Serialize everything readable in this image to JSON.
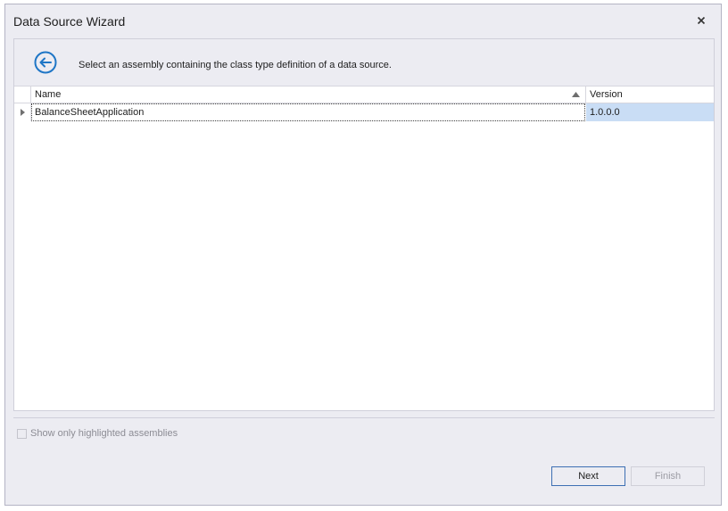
{
  "window": {
    "title": "Data Source Wizard"
  },
  "wizard": {
    "instruction": "Select an assembly containing the class type definition of a data source."
  },
  "grid": {
    "columns": [
      "Name",
      "Version"
    ],
    "rows": [
      {
        "name": "BalanceSheetApplication",
        "version": "1.0.0.0"
      }
    ]
  },
  "options": {
    "show_highlighted_label": "Show only highlighted assemblies",
    "show_highlighted_checked": false
  },
  "buttons": {
    "next": "Next",
    "finish": "Finish"
  },
  "colors": {
    "accent": "#1f76c6",
    "selection": "#c9ddf5"
  },
  "icons": {
    "close": "close-icon",
    "back": "back-arrow-icon",
    "sort": "sort-ascending-icon",
    "expand": "expand-triangle-icon"
  }
}
